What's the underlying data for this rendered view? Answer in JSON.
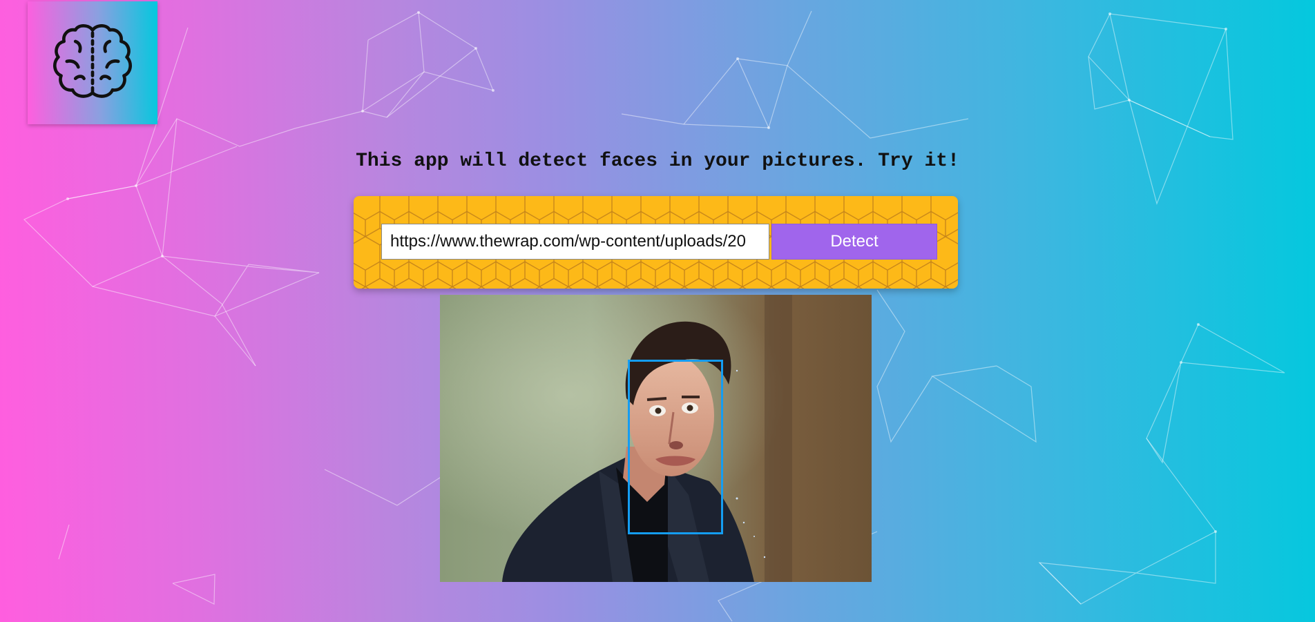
{
  "logo": {
    "icon": "brain-icon"
  },
  "tagline": "This app will detect faces in your pictures. Try it!",
  "form": {
    "url_value": "https://www.thewrap.com/wp-content/uploads/20",
    "detect_label": "Detect"
  },
  "colors": {
    "gradient_start": "#ff5edf",
    "gradient_end": "#04c8de",
    "panel_yellow": "#fdb918",
    "button_purple": "#a065ec",
    "face_box": "#149df2"
  }
}
